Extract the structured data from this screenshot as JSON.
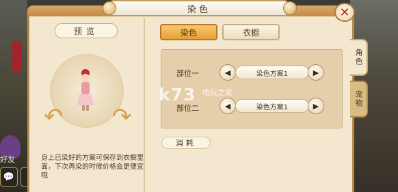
{
  "window": {
    "title": "染色",
    "close_label": "✕"
  },
  "preview": {
    "label": "预览",
    "note": "身上已染好的方案可保存到衣橱里面，下次再染的时候价格会更便宜哦"
  },
  "tabs": {
    "dye": "染色",
    "wardrobe": "衣橱"
  },
  "parts": [
    {
      "label": "部位一",
      "scheme": "染色方案1"
    },
    {
      "label": "部位二",
      "scheme": "染色方案1"
    }
  ],
  "cost": {
    "label": "消耗"
  },
  "side_tabs": {
    "role": "角色",
    "pet": "宠物"
  },
  "background": {
    "friend_label": "好友"
  },
  "watermark": {
    "main": "k73",
    "sub": "电玩之家"
  },
  "colors": {
    "accent": "#e6a23b",
    "panel": "#f3e8cf",
    "border": "#b88a4a",
    "close": "#c4241e"
  }
}
